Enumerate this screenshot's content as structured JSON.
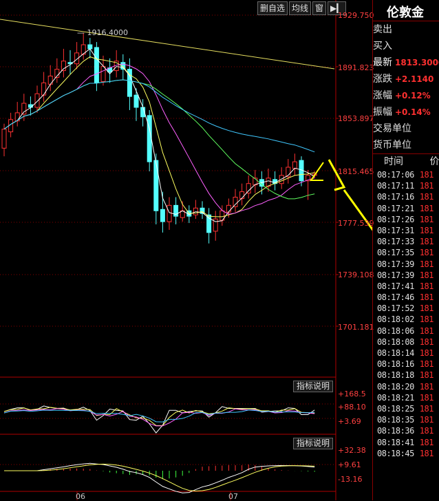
{
  "toolbar": {
    "items": [
      "删自选",
      "均线",
      "窗"
    ]
  },
  "chart_data": {
    "type": "candlestick",
    "price_axis": [
      "1929.750",
      "1891.823",
      "1853.897",
      "1815.465",
      "1777.539",
      "1739.108",
      "1701.181"
    ],
    "ylim": [
      1690,
      1935
    ],
    "high_annotation": "1916.4000",
    "x_labels": [
      "06",
      "07"
    ],
    "candles": [
      {
        "o": 1832,
        "c": 1846,
        "h": 1850,
        "l": 1826
      },
      {
        "o": 1844,
        "c": 1853,
        "h": 1858,
        "l": 1840
      },
      {
        "o": 1852,
        "c": 1858,
        "h": 1866,
        "l": 1848
      },
      {
        "o": 1857,
        "c": 1865,
        "h": 1872,
        "l": 1852
      },
      {
        "o": 1864,
        "c": 1862,
        "h": 1870,
        "l": 1856
      },
      {
        "o": 1862,
        "c": 1872,
        "h": 1878,
        "l": 1858
      },
      {
        "o": 1871,
        "c": 1880,
        "h": 1888,
        "l": 1866
      },
      {
        "o": 1879,
        "c": 1885,
        "h": 1893,
        "l": 1874
      },
      {
        "o": 1884,
        "c": 1890,
        "h": 1898,
        "l": 1880
      },
      {
        "o": 1889,
        "c": 1896,
        "h": 1905,
        "l": 1884
      },
      {
        "o": 1895,
        "c": 1894,
        "h": 1904,
        "l": 1886
      },
      {
        "o": 1894,
        "c": 1902,
        "h": 1910,
        "l": 1890
      },
      {
        "o": 1901,
        "c": 1908,
        "h": 1916.4,
        "l": 1897
      },
      {
        "o": 1908,
        "c": 1905,
        "h": 1913,
        "l": 1898
      },
      {
        "o": 1906,
        "c": 1880,
        "h": 1910,
        "l": 1874
      },
      {
        "o": 1881,
        "c": 1892,
        "h": 1900,
        "l": 1878
      },
      {
        "o": 1891,
        "c": 1888,
        "h": 1898,
        "l": 1880
      },
      {
        "o": 1889,
        "c": 1896,
        "h": 1904,
        "l": 1884
      },
      {
        "o": 1895,
        "c": 1890,
        "h": 1901,
        "l": 1882
      },
      {
        "o": 1890,
        "c": 1870,
        "h": 1898,
        "l": 1860
      },
      {
        "o": 1871,
        "c": 1862,
        "h": 1876,
        "l": 1852
      },
      {
        "o": 1862,
        "c": 1855,
        "h": 1868,
        "l": 1848
      },
      {
        "o": 1856,
        "c": 1822,
        "h": 1860,
        "l": 1815
      },
      {
        "o": 1823,
        "c": 1786,
        "h": 1828,
        "l": 1776
      },
      {
        "o": 1787,
        "c": 1778,
        "h": 1800,
        "l": 1770
      },
      {
        "o": 1778,
        "c": 1790,
        "h": 1796,
        "l": 1772
      },
      {
        "o": 1790,
        "c": 1782,
        "h": 1796,
        "l": 1776
      },
      {
        "o": 1781,
        "c": 1786,
        "h": 1793,
        "l": 1778
      },
      {
        "o": 1786,
        "c": 1782,
        "h": 1790,
        "l": 1777
      },
      {
        "o": 1783,
        "c": 1788,
        "h": 1794,
        "l": 1780
      },
      {
        "o": 1788,
        "c": 1784,
        "h": 1793,
        "l": 1780
      },
      {
        "o": 1783,
        "c": 1770,
        "h": 1788,
        "l": 1762
      },
      {
        "o": 1771,
        "c": 1780,
        "h": 1786,
        "l": 1764
      },
      {
        "o": 1779,
        "c": 1786,
        "h": 1790,
        "l": 1775
      },
      {
        "o": 1785,
        "c": 1790,
        "h": 1795,
        "l": 1781
      },
      {
        "o": 1789,
        "c": 1796,
        "h": 1802,
        "l": 1785
      },
      {
        "o": 1795,
        "c": 1800,
        "h": 1806,
        "l": 1790
      },
      {
        "o": 1799,
        "c": 1806,
        "h": 1812,
        "l": 1795
      },
      {
        "o": 1805,
        "c": 1810,
        "h": 1816,
        "l": 1799
      },
      {
        "o": 1809,
        "c": 1804,
        "h": 1815,
        "l": 1798
      },
      {
        "o": 1804,
        "c": 1810,
        "h": 1817,
        "l": 1800
      },
      {
        "o": 1809,
        "c": 1806,
        "h": 1815,
        "l": 1801
      },
      {
        "o": 1806,
        "c": 1812,
        "h": 1818,
        "l": 1802
      },
      {
        "o": 1811,
        "c": 1818,
        "h": 1824,
        "l": 1806
      },
      {
        "o": 1817,
        "c": 1822,
        "h": 1828,
        "l": 1812
      },
      {
        "o": 1823,
        "c": 1808,
        "h": 1826,
        "l": 1804
      },
      {
        "o": 1808,
        "c": 1812,
        "h": 1816,
        "l": 1794
      },
      {
        "o": 1812,
        "c": 1813,
        "h": 1815,
        "l": 1810
      }
    ],
    "ind1_axis": [
      "+168.5",
      "+88.10",
      "+3.69"
    ],
    "ind1_button": "指标说明",
    "ind2_axis": [
      "+32.38",
      "+9.61",
      "-13.16"
    ],
    "ind2_button": "指标说明"
  },
  "quote": {
    "title": "伦敦金",
    "rows": [
      {
        "label": "卖出",
        "value": ""
      },
      {
        "label": "买入",
        "value": ""
      },
      {
        "label": "最新",
        "value": "1813.3000"
      },
      {
        "label": "涨跌",
        "value": "+2.1140"
      },
      {
        "label": "涨幅",
        "value": "+0.12%"
      },
      {
        "label": "振幅",
        "value": "+0.14%"
      },
      {
        "label": "交易单位",
        "value": ""
      },
      {
        "label": "货币单位",
        "value": ""
      }
    ],
    "time_header": "时间",
    "price_header": "价",
    "ticks": [
      "08:17:06",
      "08:17:11",
      "08:17:16",
      "08:17:21",
      "08:17:26",
      "08:17:31",
      "08:17:33",
      "08:17:35",
      "08:17:39",
      "08:17:39",
      "08:17:41",
      "08:17:46",
      "08:17:52",
      "08:18:02",
      "08:18:06",
      "08:18:08",
      "08:18:14",
      "08:18:16",
      "08:18:18",
      "08:18:20",
      "08:18:21",
      "08:18:25",
      "08:18:35",
      "08:18:36",
      "08:18:41",
      "08:18:45"
    ],
    "tick_price": "181"
  },
  "colors": {
    "up": "#ff3232",
    "down": "#54ffff",
    "bg": "#000000",
    "axis": "#c00000"
  }
}
